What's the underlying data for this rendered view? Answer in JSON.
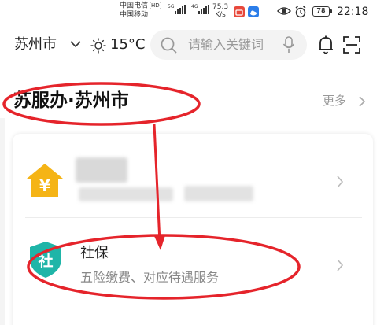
{
  "status_bar": {
    "carrier_1": "中国电信",
    "carrier_1_badge": "HD",
    "carrier_2": "中国移动",
    "network_1": "5G",
    "network_2": "4G",
    "net_speed_value": "75.3",
    "net_speed_unit": "K/s",
    "battery": "78",
    "time": "22:18"
  },
  "header": {
    "city": "苏州市",
    "temperature": "15°C",
    "search_placeholder": "请输入关键词"
  },
  "section": {
    "title": "苏服办·苏州市",
    "more_label": "更多"
  },
  "services": [
    {
      "icon": "yuan-house-icon",
      "title": "",
      "subtitle": "",
      "icon_color": "#f5b416"
    },
    {
      "icon": "social-security-shield-icon",
      "glyph": "社",
      "title": "社保",
      "subtitle": "五险缴费、对应待遇服务",
      "icon_color": "#1fb5a8"
    }
  ],
  "colors": {
    "annotation": "#e5242b",
    "wallet_badge": "#e8483b",
    "cloud_badge": "#2b7de9"
  }
}
